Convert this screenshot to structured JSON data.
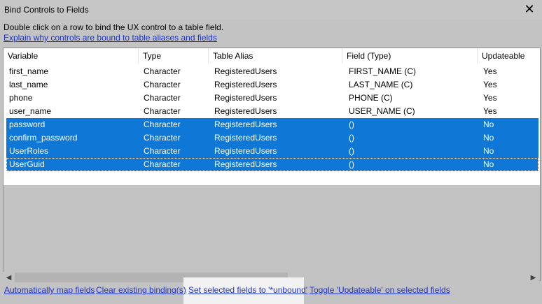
{
  "window": {
    "title": "Bind Controls to Fields",
    "close_glyph": "✕"
  },
  "instructions": "Double click on a row to bind the UX control to a table field.",
  "explain_link": "Explain why controls are bound to table aliases and fields",
  "grid": {
    "columns": [
      "Variable",
      "Type",
      "Table Alias",
      "Field (Type)",
      "Updateable"
    ],
    "rows": [
      {
        "variable": "first_name",
        "type": "Character",
        "alias": "RegisteredUsers",
        "field": "FIRST_NAME (C)",
        "updateable": "Yes",
        "selected": false
      },
      {
        "variable": "last_name",
        "type": "Character",
        "alias": "RegisteredUsers",
        "field": "LAST_NAME (C)",
        "updateable": "Yes",
        "selected": false
      },
      {
        "variable": "phone",
        "type": "Character",
        "alias": "RegisteredUsers",
        "field": "PHONE (C)",
        "updateable": "Yes",
        "selected": false
      },
      {
        "variable": "user_name",
        "type": "Character",
        "alias": "RegisteredUsers",
        "field": "USER_NAME (C)",
        "updateable": "Yes",
        "selected": false
      },
      {
        "variable": "password",
        "type": "Character",
        "alias": "RegisteredUsers",
        "field": "()",
        "updateable": "No",
        "selected": true
      },
      {
        "variable": "confirm_password",
        "type": "Character",
        "alias": "RegisteredUsers",
        "field": "()",
        "updateable": "No",
        "selected": true
      },
      {
        "variable": "UserRoles",
        "type": "Character",
        "alias": "RegisteredUsers",
        "field": "()",
        "updateable": "No",
        "selected": true
      },
      {
        "variable": "UserGuid",
        "type": "Character",
        "alias": "RegisteredUsers",
        "field": "()",
        "updateable": "No",
        "selected": true
      }
    ]
  },
  "scrollbar": {
    "left_arrow": "◀",
    "right_arrow": "▶"
  },
  "footer": {
    "auto_map": "Automatically map fields",
    "clear": "Clear existing binding(s)",
    "set_unbound": "Set selected fields to '*unbound'",
    "toggle": "Toggle 'Updateable' on selected fields"
  },
  "colors": {
    "selection": "#0f78d7",
    "link": "#1e33c9",
    "dialog_bg": "#c3c3c3"
  }
}
